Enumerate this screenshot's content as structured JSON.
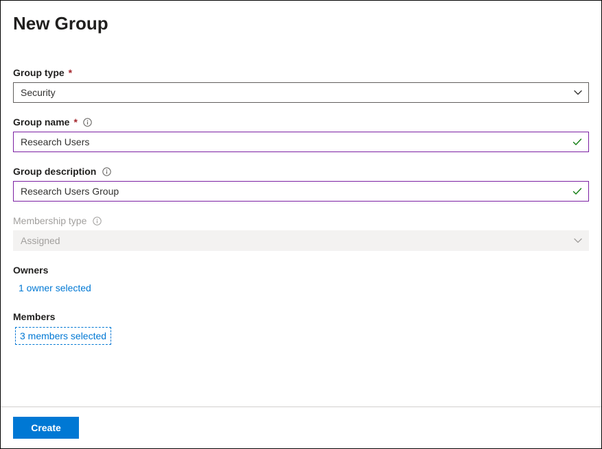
{
  "page": {
    "title": "New Group"
  },
  "fields": {
    "group_type": {
      "label": "Group type",
      "required_mark": "*",
      "value": "Security"
    },
    "group_name": {
      "label": "Group name",
      "required_mark": "*",
      "value": "Research Users"
    },
    "group_description": {
      "label": "Group description",
      "value": "Research Users Group"
    },
    "membership_type": {
      "label": "Membership type",
      "value": "Assigned"
    }
  },
  "owners": {
    "label": "Owners",
    "link_text": "1 owner selected"
  },
  "members": {
    "label": "Members",
    "link_text": "3 members selected"
  },
  "footer": {
    "create_label": "Create"
  }
}
